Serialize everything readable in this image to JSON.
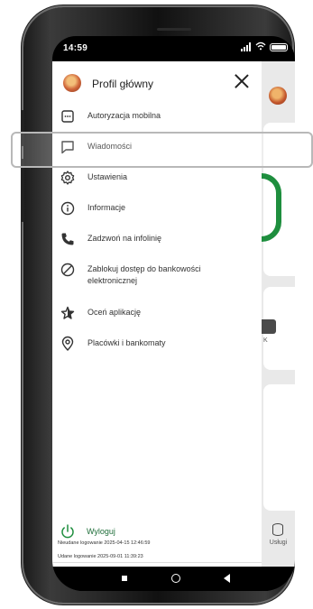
{
  "status_bar": {
    "time": "14:59"
  },
  "drawer": {
    "title": "Profil główny",
    "items": [
      {
        "label": "Autoryzacja mobilna",
        "icon": "mobile-authorization-icon"
      },
      {
        "label": "Wiadomości",
        "icon": "message-icon"
      },
      {
        "label": "Ustawienia",
        "icon": "gear-icon"
      },
      {
        "label": "Informacje",
        "icon": "info-icon"
      },
      {
        "label": "Zadzwoń na infolinię",
        "icon": "phone-icon"
      },
      {
        "label": "Zablokuj dostęp do bankowości elektronicznej",
        "icon": "block-icon"
      },
      {
        "label": "Oceń aplikację",
        "icon": "star-icon"
      },
      {
        "label": "Placówki i bankomaty",
        "icon": "location-pin-icon"
      }
    ],
    "logout_label": "Wyloguj",
    "last_login": "Udane logowanie 2025-09-01 11:39:23",
    "failed_login": "Nieudane logowanie 2025-04-15 12:46:59"
  },
  "background_app": {
    "services_label": "Usługi",
    "partial_label": "K"
  },
  "colors": {
    "accent_green": "#1e8e3e",
    "logout_green": "#1f6e3a"
  }
}
